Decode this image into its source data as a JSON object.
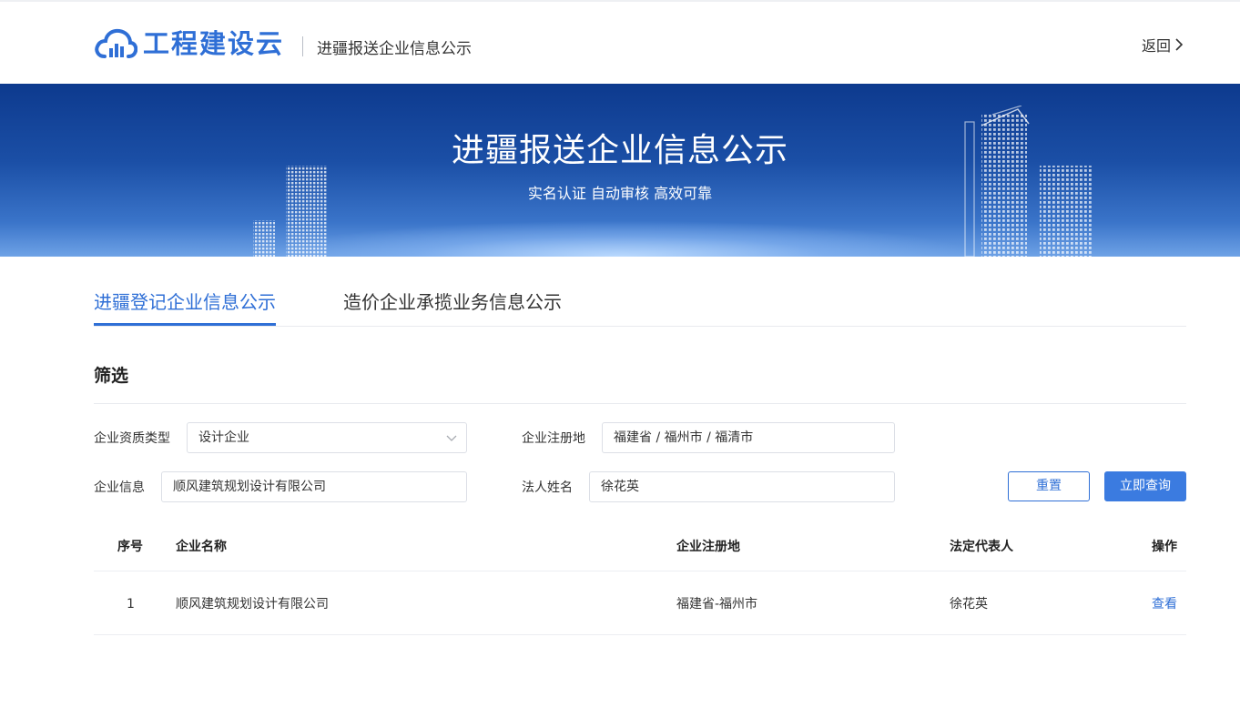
{
  "header": {
    "brand": "工程建设云",
    "subtitle": "进疆报送企业信息公示",
    "back_label": "返回"
  },
  "banner": {
    "title": "进疆报送企业信息公示",
    "subtitle": "实名认证 自动审核 高效可靠"
  },
  "tabs": [
    {
      "label": "进疆登记企业信息公示",
      "active": true
    },
    {
      "label": "造价企业承揽业务信息公示",
      "active": false
    }
  ],
  "filter": {
    "title": "筛选",
    "qualification_type": {
      "label": "企业资质类型",
      "value": "设计企业"
    },
    "registered_place": {
      "label": "企业注册地",
      "value": "福建省 / 福州市 / 福清市"
    },
    "company_info": {
      "label": "企业信息",
      "value": "顺风建筑规划设计有限公司"
    },
    "legal_person": {
      "label": "法人姓名",
      "value": "徐花英"
    },
    "reset_label": "重置",
    "query_label": "立即查询"
  },
  "table": {
    "headers": [
      "序号",
      "企业名称",
      "企业注册地",
      "法定代表人",
      "操作"
    ],
    "rows": [
      {
        "index": "1",
        "name": "顺风建筑规划设计有限公司",
        "place": "福建省-福州市",
        "legal": "徐花英",
        "action": "查看"
      }
    ]
  },
  "colors": {
    "primary": "#2f6fd6",
    "banner_dark": "#0d3a8e"
  }
}
